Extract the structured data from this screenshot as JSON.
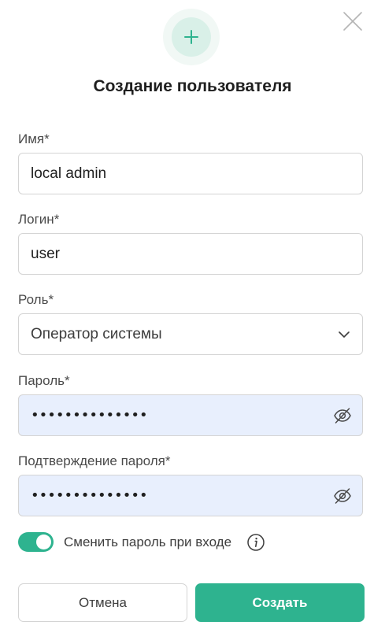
{
  "dialog": {
    "title": "Создание пользователя"
  },
  "fields": {
    "name": {
      "label": "Имя*",
      "value": "local admin"
    },
    "login": {
      "label": "Логин*",
      "value": "user"
    },
    "role": {
      "label": "Роль*",
      "value": "Оператор системы"
    },
    "password": {
      "label": "Пароль*",
      "value": "••••••••••••••"
    },
    "password_confirm": {
      "label": "Подтверждение пароля*",
      "value": "••••••••••••••"
    }
  },
  "change_password_toggle": {
    "label": "Сменить пароль при входе",
    "enabled": true
  },
  "buttons": {
    "cancel": "Отмена",
    "create": "Создать"
  },
  "icons": {
    "header": "plus-icon",
    "close": "close-icon",
    "role_dropdown": "chevron-down-icon",
    "password_visibility": "eye-off-icon",
    "info": "info-icon"
  },
  "colors": {
    "accent": "#2eb38f",
    "autofill_background": "#e8effd",
    "icon_circle_outer": "#f1f8f5",
    "icon_circle_inner": "#d9f0e8"
  }
}
